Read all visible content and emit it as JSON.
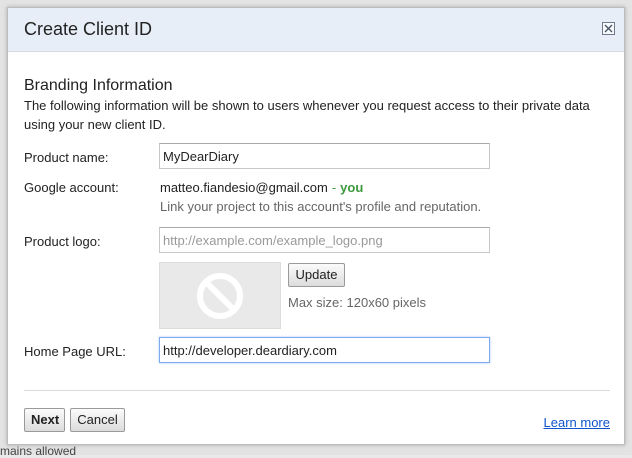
{
  "backdrop": {
    "partial_text": "mains allowed"
  },
  "dialog": {
    "title": "Create Client ID",
    "close_label": "Close"
  },
  "branding": {
    "section_title": "Branding Information",
    "description": "The following information will be shown to users whenever you request access to their private data using your new client ID."
  },
  "product_name": {
    "label": "Product name:",
    "value": "MyDearDiary"
  },
  "google_account": {
    "label": "Google account:",
    "email": "matteo.fiandesio@gmail.com",
    "separator": "-",
    "you_label": "you",
    "hint": "Link your project to this account's profile and reputation."
  },
  "product_logo": {
    "label": "Product logo:",
    "placeholder": "http://example.com/example_logo.png",
    "update_label": "Update",
    "max_size_hint": "Max size: 120x60 pixels"
  },
  "home_page": {
    "label": "Home Page URL:",
    "value": "http://developer.deardiary.com"
  },
  "footer": {
    "next_label": "Next",
    "cancel_label": "Cancel",
    "learn_more_label": "Learn more"
  },
  "colors": {
    "titlebar_bg": "#e8eef7",
    "you_green": "#3b9a3b",
    "link_blue": "#1155cc",
    "focus_blue": "#7eaaf0"
  }
}
